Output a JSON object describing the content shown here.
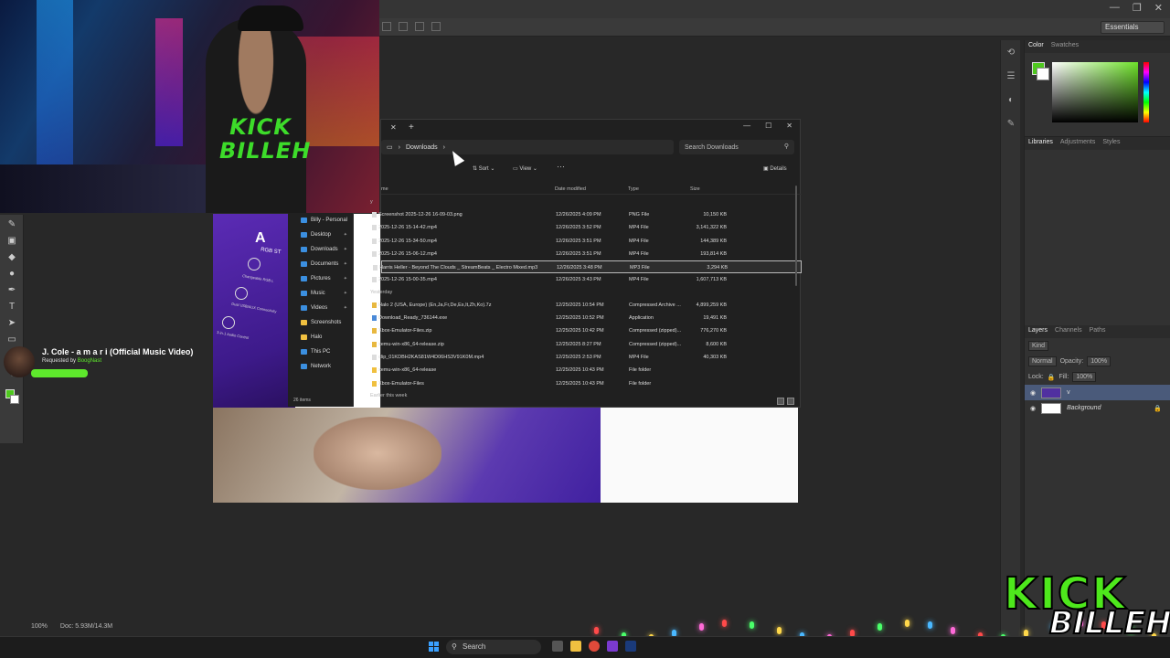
{
  "photoshop": {
    "workspace": "Essentials",
    "panels": {
      "color_tab": "Color",
      "swatches_tab": "Swatches",
      "libraries_tab": "Libraries",
      "adjustments_tab": "Adjustments",
      "styles_tab": "Styles",
      "layers_tab": "Layers",
      "channels_tab": "Channels",
      "paths_tab": "Paths"
    },
    "layers": {
      "kind_filter": "Kind",
      "blend_mode": "Normal",
      "opacity_label": "Opacity:",
      "opacity_value": "100%",
      "lock_label": "Lock:",
      "fill_label": "Fill:",
      "fill_value": "100%",
      "items": [
        {
          "name": "v",
          "selected": true
        },
        {
          "name": "Background",
          "selected": false
        }
      ]
    },
    "status": {
      "zoom": "100%",
      "doc": "Doc: 5.93M/14.3M"
    },
    "foreground_color": "#4ec81e",
    "background_color": "#ffffff"
  },
  "music_widget": {
    "title": "J. Cole - a m a r i (Official Music Video)",
    "requested_prefix": "Requested by",
    "requested_by": "BoogNast"
  },
  "explorer": {
    "breadcrumb": "Downloads",
    "search_placeholder": "Search Downloads",
    "toolbar": {
      "sort": "Sort",
      "view": "View",
      "more": "···",
      "details": "Details"
    },
    "sidebar": [
      {
        "label": "Billy - Personal",
        "icon": "cloud-icon"
      },
      {
        "label": "Desktop",
        "icon": "desktop-icon",
        "pinned": true
      },
      {
        "label": "Downloads",
        "icon": "download-icon",
        "pinned": true
      },
      {
        "label": "Documents",
        "icon": "document-icon",
        "pinned": true
      },
      {
        "label": "Pictures",
        "icon": "picture-icon",
        "pinned": true
      },
      {
        "label": "Music",
        "icon": "music-icon",
        "pinned": true
      },
      {
        "label": "Videos",
        "icon": "video-icon",
        "pinned": true
      },
      {
        "label": "Screenshots",
        "icon": "folder-icon"
      },
      {
        "label": "Halo",
        "icon": "folder-icon"
      },
      {
        "label": "This PC",
        "icon": "pc-icon"
      },
      {
        "label": "Network",
        "icon": "network-icon"
      }
    ],
    "columns": {
      "name": "me",
      "date": "Date modified",
      "type": "Type",
      "size": "Size"
    },
    "today_group": "y",
    "today_rows": [
      {
        "name": "Screenshot 2025-12-26 16-09-03.png",
        "date": "12/26/2025 4:09 PM",
        "type": "PNG File",
        "size": "10,150 KB",
        "kind": "file"
      },
      {
        "name": "2025-12-26 15-14-42.mp4",
        "date": "12/26/2025 3:52 PM",
        "type": "MP4 File",
        "size": "3,141,322 KB",
        "kind": "file"
      },
      {
        "name": "2025-12-26 15-34-50.mp4",
        "date": "12/26/2025 3:51 PM",
        "type": "MP4 File",
        "size": "144,389 KB",
        "kind": "file"
      },
      {
        "name": "2025-12-26 15-06-12.mp4",
        "date": "12/26/2025 3:51 PM",
        "type": "MP4 File",
        "size": "193,814 KB",
        "kind": "file"
      },
      {
        "name": "Harris Heller - Beyond The Clouds _ StreamBeats _ Electro Mixed.mp3",
        "date": "12/26/2025 3:48 PM",
        "type": "MP3 File",
        "size": "3,294 KB",
        "kind": "file",
        "selected": true
      },
      {
        "name": "2025-12-26 15-00-35.mp4",
        "date": "12/26/2025 3:43 PM",
        "type": "MP4 File",
        "size": "1,607,713 KB",
        "kind": "file"
      }
    ],
    "yesterday_group": "Yesterday",
    "yesterday_rows": [
      {
        "name": "Halo 2 (USA, Europe) (En,Ja,Fr,De,Es,It,Zh,Ko).7z",
        "date": "12/25/2025 10:54 PM",
        "type": "Compressed Archive ...",
        "size": "4,899,259 KB",
        "kind": "zip"
      },
      {
        "name": "Download_Ready_736144.exe",
        "date": "12/25/2025 10:52 PM",
        "type": "Application",
        "size": "19,491 KB",
        "kind": "exe"
      },
      {
        "name": "Xbox-Emulator-Files.zip",
        "date": "12/25/2025 10:42 PM",
        "type": "Compressed (zipped)...",
        "size": "776,270 KB",
        "kind": "zip"
      },
      {
        "name": "xemu-win-x86_64-release.zip",
        "date": "12/25/2025 8:27 PM",
        "type": "Compressed (zipped)...",
        "size": "8,600 KB",
        "kind": "zip"
      },
      {
        "name": "clip_01KDBH2KAS81W4D06HS3V91K0M.mp4",
        "date": "12/25/2025 2:53 PM",
        "type": "MP4 File",
        "size": "40,303 KB",
        "kind": "file"
      },
      {
        "name": "xemu-win-x86_64-release",
        "date": "12/25/2025 10:43 PM",
        "type": "File folder",
        "size": "",
        "kind": "folder"
      },
      {
        "name": "Xbox-Emulator-Files",
        "date": "12/25/2025 10:43 PM",
        "type": "File folder",
        "size": "",
        "kind": "folder"
      }
    ],
    "earlier_group": "Earlier this week",
    "item_count": "26 items"
  },
  "canvas": {
    "box_title": "A",
    "box_subtitle": "RGB ST",
    "box_notes": [
      "Changeable RGB L",
      "Dual USB/AUX Connectivity",
      "3-in-1 Audio Control"
    ]
  },
  "webcam": {
    "shirt_line1": "KICK",
    "shirt_line2": "BILLEH"
  },
  "taskbar": {
    "search": "Search"
  },
  "kick_logo": {
    "line1": "KICK",
    "line2": "BILLEH"
  }
}
